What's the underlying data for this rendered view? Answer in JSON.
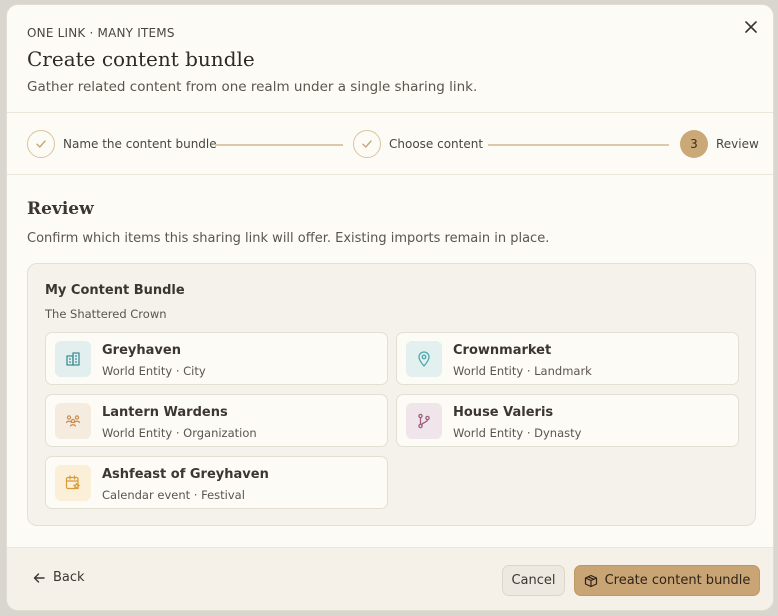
{
  "header": {
    "eyebrow": "ONE LINK · MANY ITEMS",
    "title": "Create content bundle",
    "subtitle": "Gather related content from one realm under a single sharing link.",
    "close_icon": "close-icon"
  },
  "stepper": {
    "steps": [
      {
        "label": "Name the content bundle",
        "status": "done",
        "icon": "check-icon"
      },
      {
        "label": "Choose content",
        "status": "done",
        "icon": "check-icon"
      },
      {
        "label": "Review",
        "status": "active",
        "number": "3"
      }
    ]
  },
  "review": {
    "title": "Review",
    "description": "Confirm which items this sharing link will offer. Existing imports remain in place."
  },
  "bundle": {
    "name": "My Content Bundle",
    "realm": "The Shattered Crown",
    "items": [
      {
        "title": "Greyhaven",
        "subtitle": "World Entity · City",
        "icon": "city-icon",
        "icon_bg": "#e3eeee",
        "icon_color": "#3f8f93"
      },
      {
        "title": "Crownmarket",
        "subtitle": "World Entity · Landmark",
        "icon": "map-pin-icon",
        "icon_bg": "#e3f0f0",
        "icon_color": "#4ea6ac"
      },
      {
        "title": "Lantern Wardens",
        "subtitle": "World Entity · Organization",
        "icon": "people-icon",
        "icon_bg": "#f6ebdf",
        "icon_color": "#c98f52"
      },
      {
        "title": "House Valeris",
        "subtitle": "World Entity · Dynasty",
        "icon": "family-tree-icon",
        "icon_bg": "#efe5ea",
        "icon_color": "#a0607a"
      },
      {
        "title": "Ashfeast of Greyhaven",
        "subtitle": "Calendar event · Festival",
        "icon": "calendar-star-icon",
        "icon_bg": "#fbefd7",
        "icon_color": "#d99b3a"
      }
    ]
  },
  "footer": {
    "back_label": "Back",
    "cancel_label": "Cancel",
    "create_label": "Create content bundle"
  },
  "colors": {
    "accent": "#c9a474",
    "background": "#fdfbf5"
  }
}
